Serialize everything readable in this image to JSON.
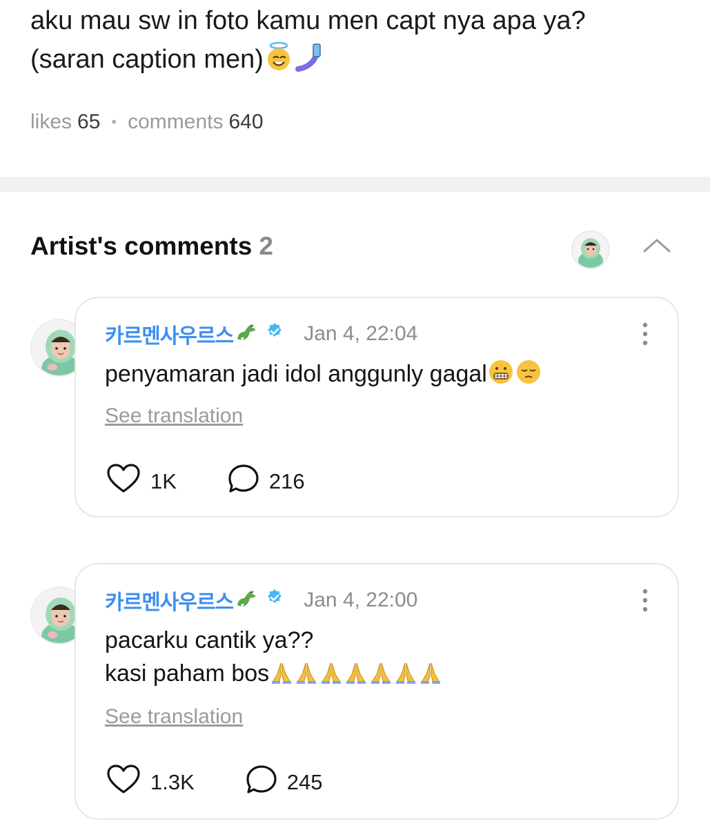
{
  "post": {
    "text": "aku mau sw in foto kamu men capt nya apa ya?\n(saran caption men)",
    "emojis": [
      "halo-smile-emoji",
      "selfie-emoji"
    ],
    "likes_label": "likes",
    "likes_count": "65",
    "comments_label": "comments",
    "comments_count": "640"
  },
  "artist_comments": {
    "title": "Artist's comments",
    "count": "2",
    "comments": [
      {
        "username": "카르멘사우르스",
        "timestamp": "Jan 4, 22:04",
        "body": "penyamaran jadi idol anggunly gagal",
        "body_emojis": [
          "grimace-emoji",
          "pensive-emoji"
        ],
        "see_translation": "See translation",
        "likes": "1K",
        "replies": "216"
      },
      {
        "username": "카르멘사우르스",
        "timestamp": "Jan 4, 22:00",
        "body": "pacarku cantik ya??\nkasi paham bos",
        "body_emojis": [
          "pray-emoji",
          "pray-emoji",
          "pray-emoji",
          "pray-emoji",
          "pray-emoji",
          "pray-emoji",
          "pray-emoji"
        ],
        "see_translation": "See translation",
        "likes": "1.3K",
        "replies": "245"
      }
    ]
  },
  "colors": {
    "username": "#3c8ef0",
    "verified_badge": "#4ab6f0",
    "muted_text": "#9a9a9a",
    "card_border": "#e6e6e6",
    "divider": "#f1f1f1"
  }
}
